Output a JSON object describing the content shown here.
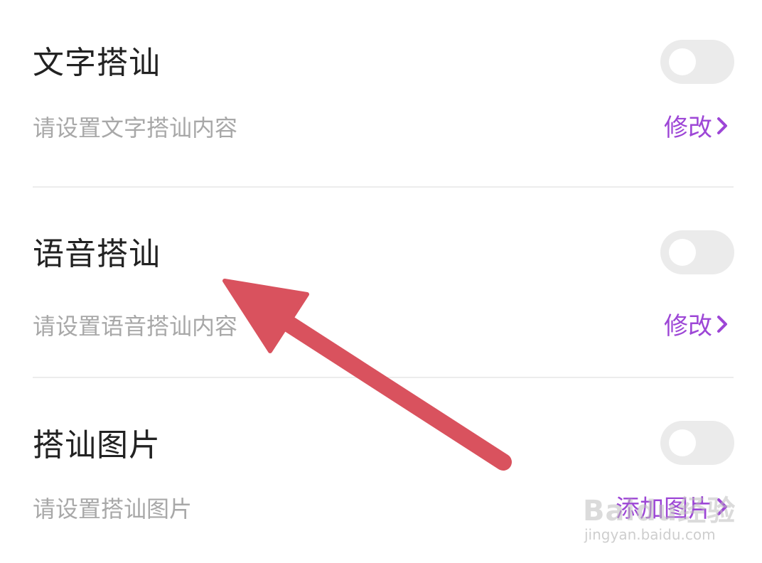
{
  "settings": [
    {
      "title": "文字搭讪",
      "subtitle": "请设置文字搭讪内容",
      "action": "修改",
      "enabled": false
    },
    {
      "title": "语音搭讪",
      "subtitle": "请设置语音搭讪内容",
      "action": "修改",
      "enabled": false
    },
    {
      "title": "搭讪图片",
      "subtitle": "请设置搭讪图片",
      "action": "添加图片",
      "enabled": false
    }
  ],
  "watermark": {
    "brand": "Baidu经验",
    "url": "jingyan.baidu.com"
  },
  "colors": {
    "accent": "#9d46d6",
    "arrow": "#d9525e",
    "toggle_off": "#ebebeb"
  },
  "icons": {
    "chevron": "chevron-right-icon",
    "annotation": "red-arrow-icon"
  }
}
